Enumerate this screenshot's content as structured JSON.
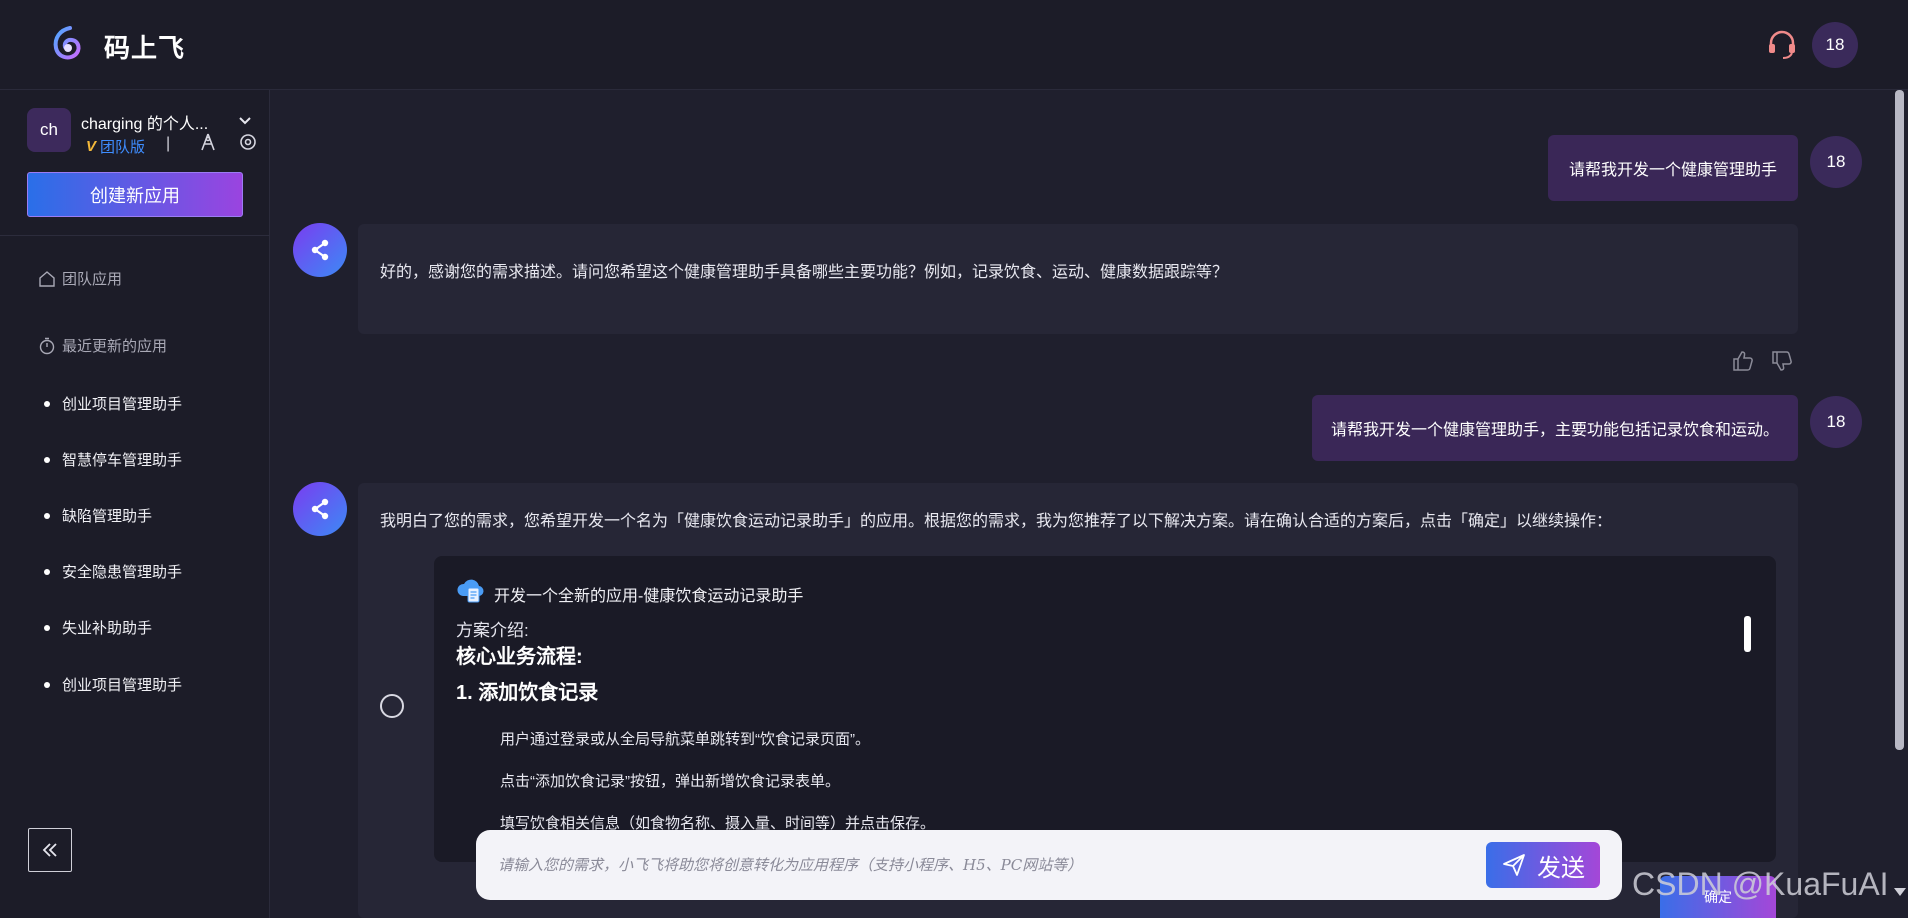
{
  "header": {
    "brand": "码上飞",
    "logo_icon": "brand-logo-icon",
    "support_icon": "headset-icon",
    "user_initials": "18"
  },
  "sidebar": {
    "workspace_initials": "ch",
    "workspace_name": "charging 的个人...",
    "edition_mark": "V",
    "edition": "团队版",
    "separator": "|",
    "create_button": "创建新应用",
    "nav": [
      {
        "label": "团队应用",
        "icon": "home-icon"
      },
      {
        "label": "最近更新的应用",
        "icon": "stopwatch-icon"
      }
    ],
    "recent_apps": [
      "创业项目管理助手",
      "智慧停车管理助手",
      "缺陷管理助手",
      "安全隐患管理助手",
      "失业补助助手",
      "创业项目管理助手"
    ]
  },
  "chat": {
    "messages": [
      {
        "role": "user",
        "text": "请帮我开发一个健康管理助手",
        "avatar": "18"
      },
      {
        "role": "bot",
        "text": "好的，感谢您的需求描述。请问您希望这个健康管理助手具备哪些主要功能？例如，记录饮食、运动、健康数据跟踪等？"
      },
      {
        "role": "user",
        "text": "请帮我开发一个健康管理助手，主要功能包括记录饮食和运动。",
        "avatar": "18"
      },
      {
        "role": "bot",
        "text": "我明白了您的需求，您希望开发一个名为「健康饮食运动记录助手」的应用。根据您的需求，我为您推荐了以下解决方案。请在确认合适的方案后，点击「确定」以继续操作："
      }
    ],
    "plan": {
      "title": "开发一个全新的应用-健康饮食运动记录助手",
      "intro_label": "方案介绍:",
      "heading": "核心业务流程:",
      "subheading": "1. 添加饮食记录",
      "steps": [
        "用户通过登录或从全局导航菜单跳转到“饮食记录页面”。",
        "点击“添加饮食记录”按钮，弹出新增饮食记录表单。",
        "填写饮食相关信息（如食物名称、摄入量、时间等）并点击保存。"
      ]
    },
    "confirm_button": "确定"
  },
  "input": {
    "placeholder": "请输入您的需求，小飞飞将助您将创意转化为应用程序（支持小程序、H5、PC网站等）",
    "value": "",
    "send_label": "发送"
  },
  "watermark": "CSDN @KuaFuAI",
  "colors": {
    "background": "#1f1f2d",
    "user_bubble": "#3a2757",
    "bot_bubble": "#262636",
    "accent_blue": "#3a6ee8",
    "accent_purple": "#a447d8"
  }
}
